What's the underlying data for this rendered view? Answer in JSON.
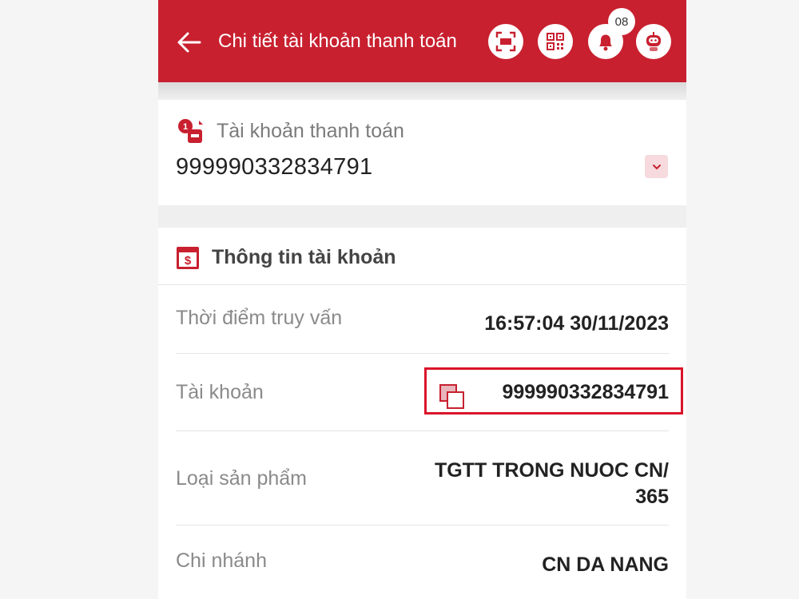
{
  "header": {
    "title": "Chi tiết tài khoản thanh toán",
    "notification_count": "08",
    "icons": [
      "arrow-left-icon",
      "scan-icon",
      "qr-code-icon",
      "bell-icon",
      "robot-icon"
    ],
    "background_color": "#c8202f"
  },
  "account_selector": {
    "label": "Tài khoản thanh toán",
    "account_number": "999990332834791",
    "icons": [
      "account-icon",
      "chevron-down-icon"
    ]
  },
  "account_info": {
    "title": "Thông tin tài khoản",
    "icon": "dollar-document-icon",
    "rows": [
      {
        "label": "Thời điểm truy vấn",
        "value": "16:57:04 30/11/2023"
      },
      {
        "label": "Tài khoản",
        "value": "999990332834791"
      },
      {
        "label": "Loại sản phẩm",
        "value_line1": "TGTT TRONG NUOC CN/",
        "value_line2": "365"
      },
      {
        "label": "Chi nhánh",
        "value": "CN DA NANG"
      }
    ],
    "highlight_color": "#d9142a"
  }
}
